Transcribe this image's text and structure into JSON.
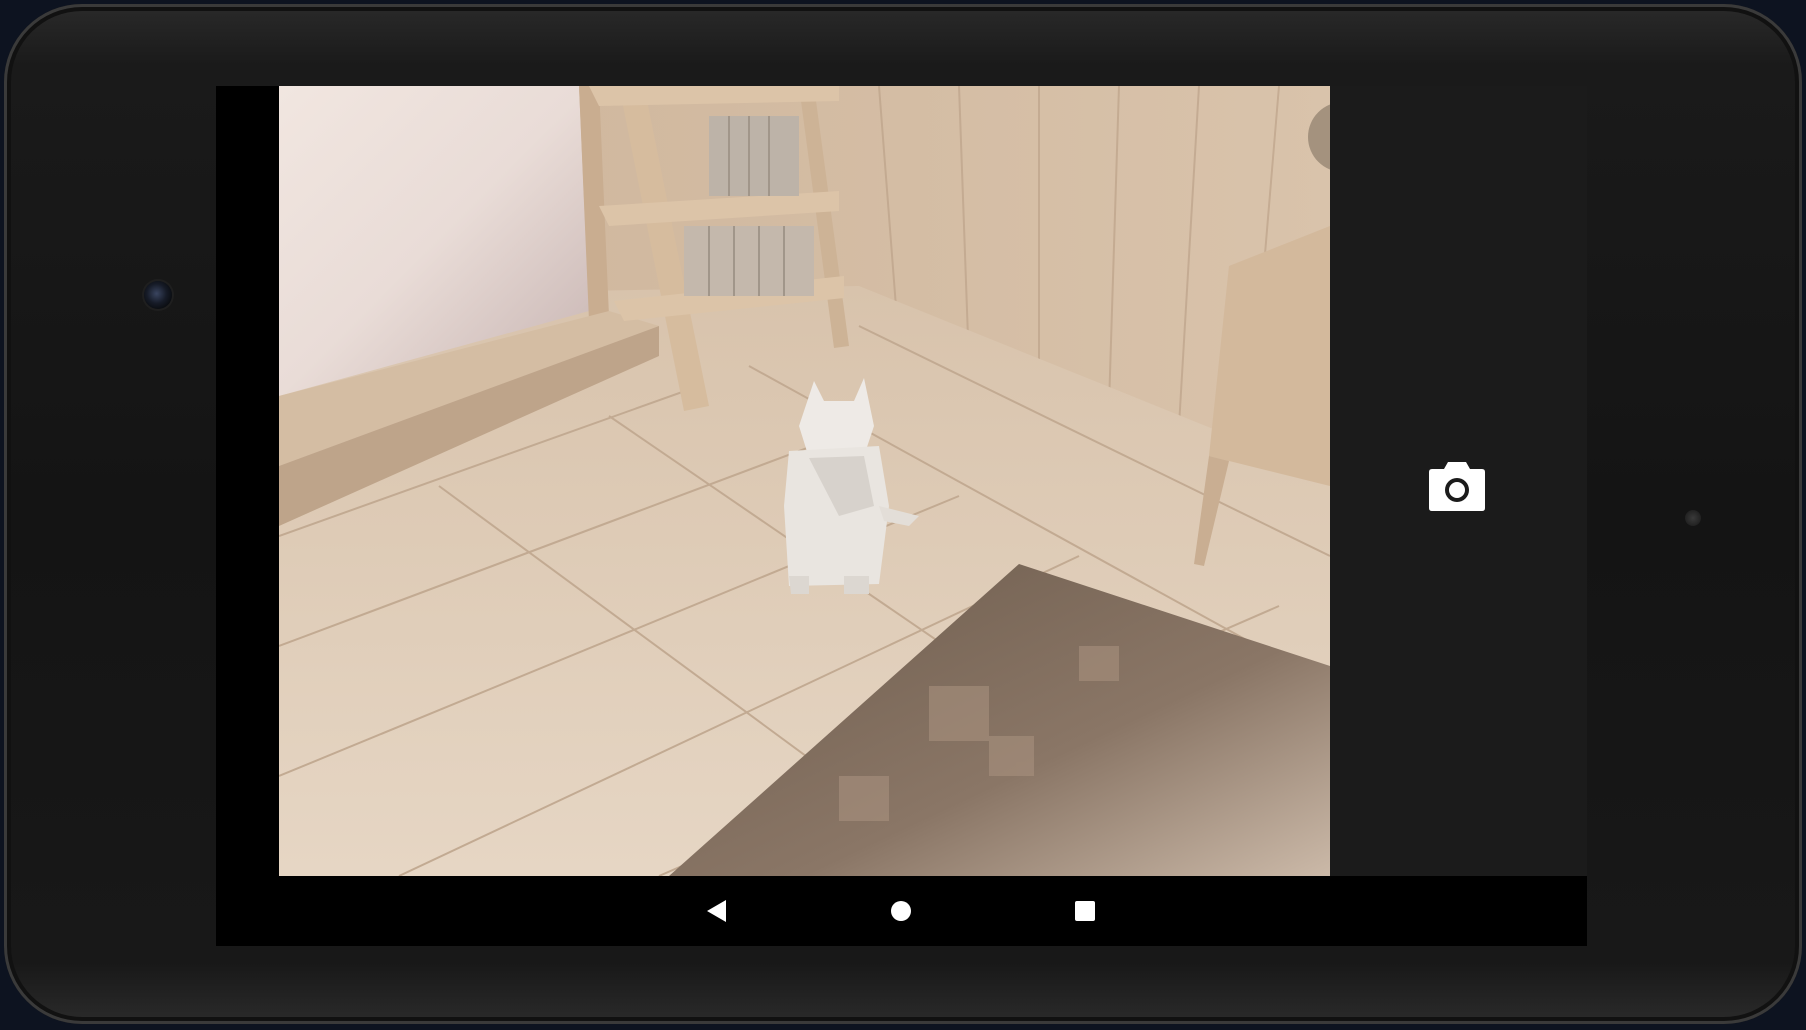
{
  "app": {
    "screen": "camera-preview"
  },
  "viewfinder": {
    "scene": "room-with-paper-cat"
  },
  "toolbar": {
    "overflow_icon": "more-vert-icon",
    "shutter_icon": "camera-icon"
  },
  "navigation": {
    "back_icon": "back-triangle-icon",
    "home_icon": "home-circle-icon",
    "recents_icon": "recents-square-icon"
  },
  "colors": {
    "side_panel": "#1b1b1b",
    "nav_bar": "#000000",
    "icon": "#ffffff"
  }
}
